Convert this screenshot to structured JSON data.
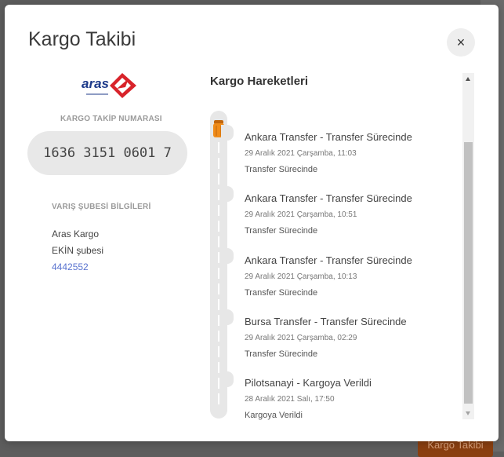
{
  "modal": {
    "title": "Kargo Takibi",
    "close_label": "×"
  },
  "left": {
    "logo_text": "aras",
    "tracking_label": "KARGO TAKİP NUMARASI",
    "tracking_number": "1636 3151 0601 7",
    "branch_label": "VARIŞ ŞUBESİ BİLGİLERİ",
    "company": "Aras Kargo",
    "branch": "EKİN şubesi",
    "phone": "4442552"
  },
  "movements": {
    "title": "Kargo Hareketleri",
    "events": [
      {
        "title": "Ankara Transfer - Transfer Sürecinde",
        "date": "29 Aralık 2021 Çarşamba, 11:03",
        "status": "Transfer Sürecinde"
      },
      {
        "title": "Ankara Transfer - Transfer Sürecinde",
        "date": "29 Aralık 2021 Çarşamba, 10:51",
        "status": "Transfer Sürecinde"
      },
      {
        "title": "Ankara Transfer - Transfer Sürecinde",
        "date": "29 Aralık 2021 Çarşamba, 10:13",
        "status": "Transfer Sürecinde"
      },
      {
        "title": "Bursa Transfer - Transfer Sürecinde",
        "date": "29 Aralık 2021 Çarşamba, 02:29",
        "status": "Transfer Sürecinde"
      },
      {
        "title": "Pilotsanayi - Kargoya Verildi",
        "date": "28 Aralık 2021 Salı, 17:50",
        "status": "Kargoya Verildi"
      }
    ]
  },
  "background": {
    "button_label": "Kargo Takibi"
  },
  "colors": {
    "accent_orange": "#f08c1a",
    "logo_red": "#d8232a",
    "logo_navy": "#1d3a8a",
    "phone_blue": "#5872cf"
  },
  "icons": [
    "close-icon",
    "aras-logo",
    "cargo-pin-icon"
  ]
}
